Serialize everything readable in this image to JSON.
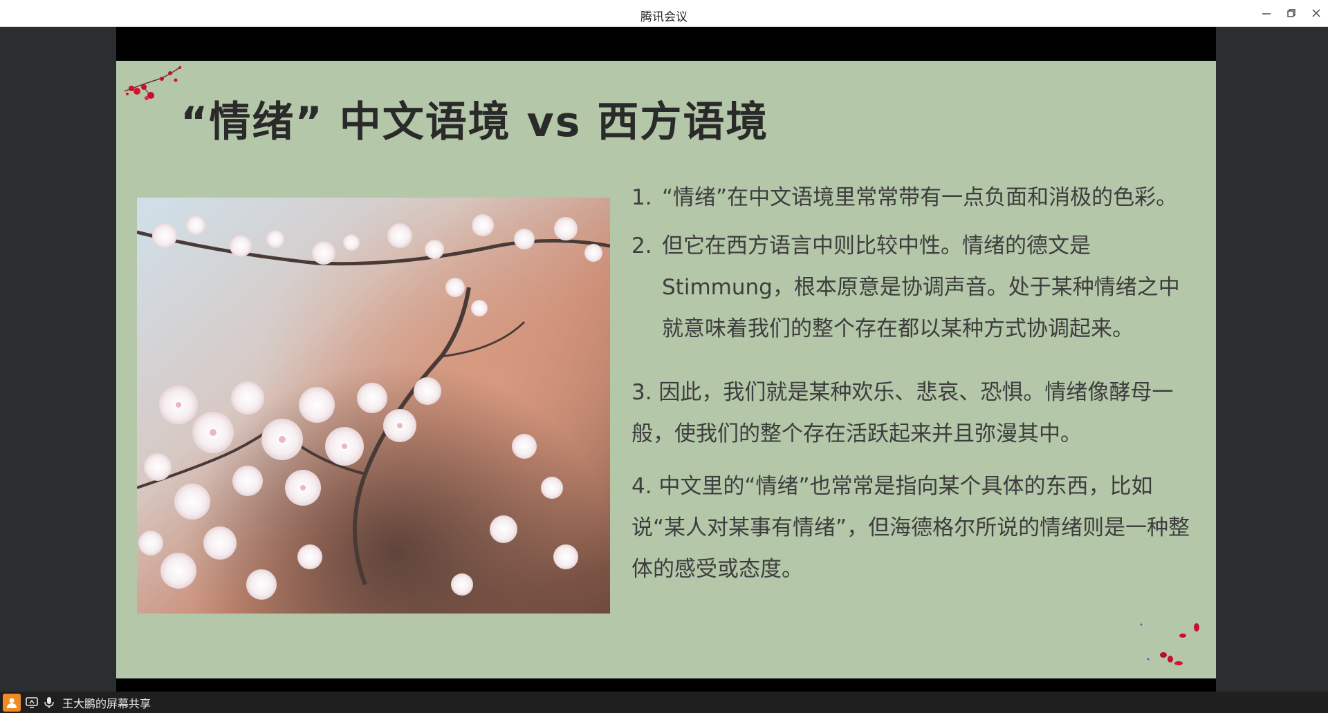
{
  "window": {
    "title": "腾讯会议"
  },
  "slide": {
    "title": "“情绪” 中文语境 vs 西方语境",
    "points": [
      {
        "num": "1.",
        "text": "“情绪”在中文语境里常常带有一点负面和消极的色彩。"
      },
      {
        "num": "2.",
        "text": "但它在西方语言中则比较中性。情绪的德文是Stimmung，根本原意是协调声音。处于某种情绪之中就意味着我们的整个存在都以某种方式协调起来。"
      },
      {
        "text": "3. 因此，我们就是某种欢乐、悲哀、恐惧。情绪像酵母一般，使我们的整个存在活跃起来并且弥漫其中。"
      },
      {
        "text": "4. 中文里的“情绪”也常常是指向某个具体的东西，比如说“某人对某事有情绪”，但海德格尔所说的情绪则是一种整体的感受或态度。"
      }
    ],
    "background_color": "#b4c7a9"
  },
  "bottom_bar": {
    "share_label": "王大鹏的屏幕共享",
    "icons": [
      "user-icon",
      "screen-share-icon",
      "microphone-icon"
    ]
  }
}
